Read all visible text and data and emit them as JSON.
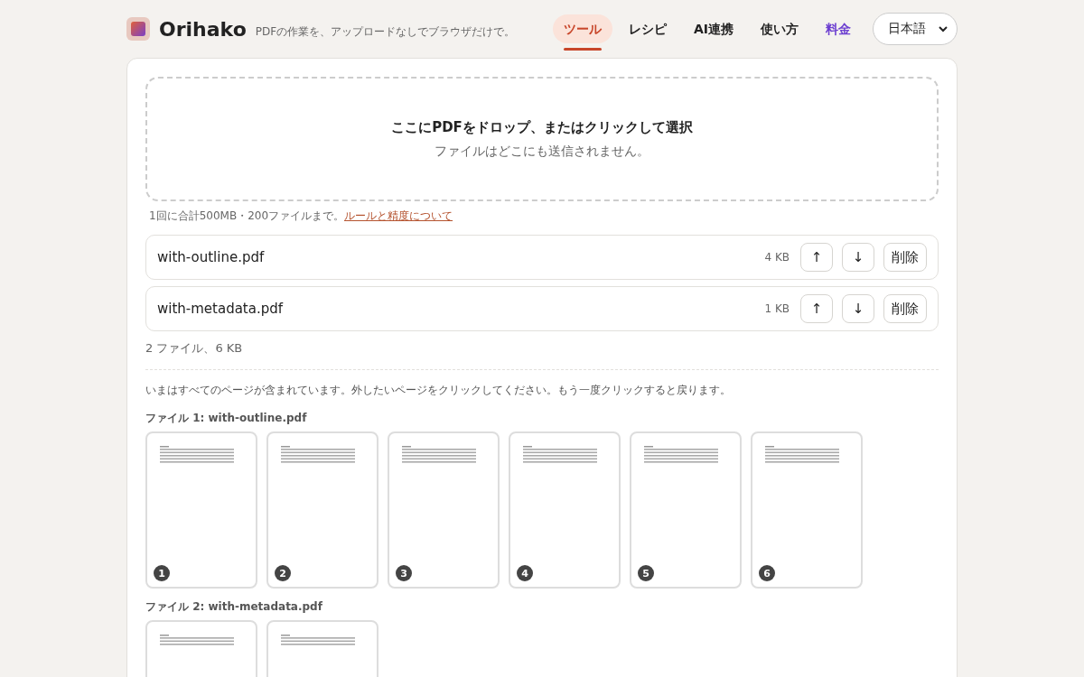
{
  "header": {
    "brand": "Orihako",
    "tagline": "PDFの作業を、アップロードなしでブラウザだけで。",
    "nav": [
      {
        "label": "ツール",
        "selected": true,
        "accent": false
      },
      {
        "label": "レシピ",
        "selected": false,
        "accent": false
      },
      {
        "label": "AI連携",
        "selected": false,
        "accent": false
      },
      {
        "label": "使い方",
        "selected": false,
        "accent": false
      },
      {
        "label": "料金",
        "selected": false,
        "accent": true
      }
    ],
    "language": "日本語"
  },
  "dropzone": {
    "title": "ここにPDFをドロップ、またはクリックして選択",
    "subtitle": "ファイルはどこにも送信されません。"
  },
  "limit_note": {
    "text": "1回に合計500MB・200ファイルまで。",
    "link": "ルールと精度について"
  },
  "files": [
    {
      "name": "with-outline.pdf",
      "size": "4 KB",
      "up": "↑",
      "down": "↓",
      "remove": "削除"
    },
    {
      "name": "with-metadata.pdf",
      "size": "1 KB",
      "up": "↑",
      "down": "↓",
      "remove": "削除"
    }
  ],
  "summary": "2 ファイル、6 KB",
  "instructions": "いまはすべてのページが含まれています。外したいページをクリックしてください。もう一度クリックすると戻ります。",
  "page_groups": [
    {
      "title": "ファイル 1: with-outline.pdf",
      "pages": [
        {
          "number": "1",
          "selected": false
        },
        {
          "number": "2",
          "selected": false
        },
        {
          "number": "3",
          "selected": false
        },
        {
          "number": "4",
          "selected": false
        },
        {
          "number": "5",
          "selected": false
        },
        {
          "number": "6",
          "selected": false
        }
      ]
    },
    {
      "title": "ファイル 2: with-metadata.pdf",
      "pages": [
        {
          "selected": false
        },
        {
          "selected": false
        }
      ]
    }
  ]
}
